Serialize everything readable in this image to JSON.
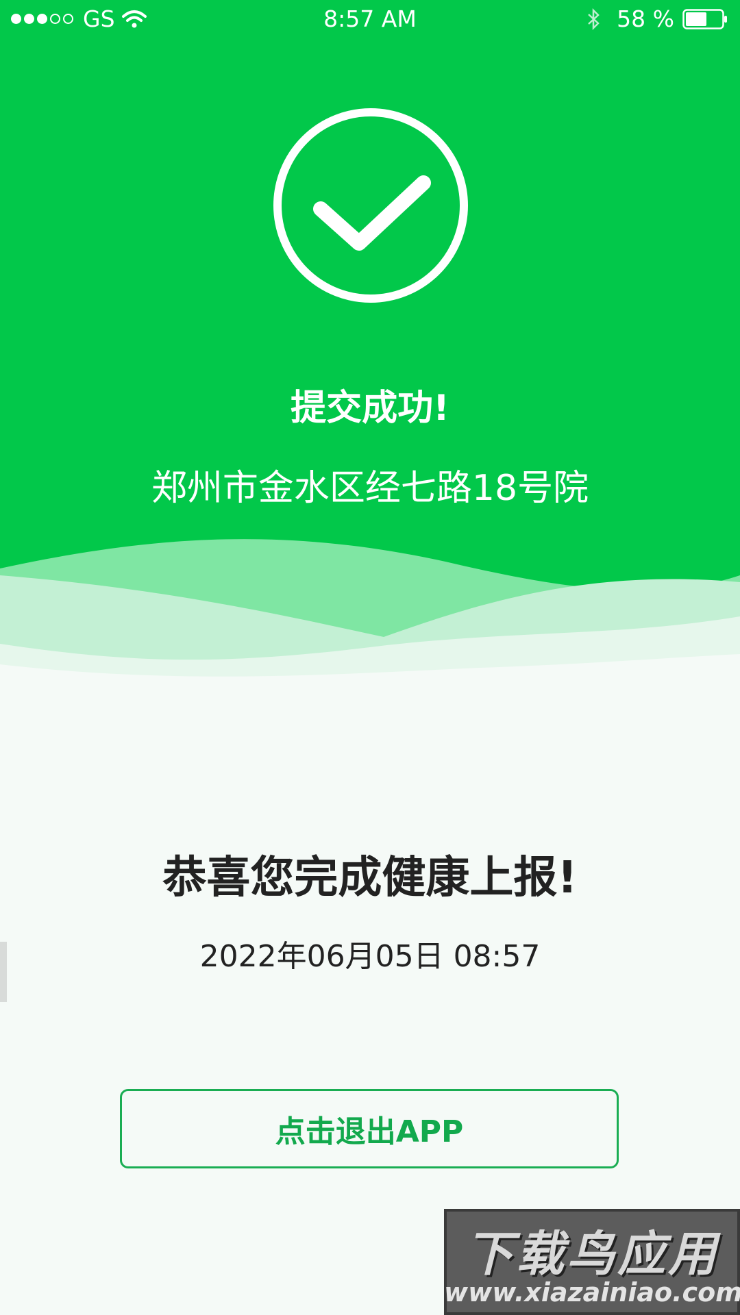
{
  "status_bar": {
    "carrier": "GS",
    "time": "8:57 AM",
    "battery": "58 %",
    "battery_level": 0.58,
    "signal_bars": 3,
    "signal_total": 5
  },
  "result": {
    "title": "提交成功!",
    "address": "郑州市金水区经七路18号院"
  },
  "message": {
    "congrats": "恭喜您完成健康上报!",
    "datetime": "2022年06月05日  08:57"
  },
  "actions": {
    "exit_label": "点击退出APP"
  },
  "watermark": {
    "logo_text": "下载鸟应用",
    "url": "www.xiazainiao.com"
  },
  "colors": {
    "primary_green": "#02c84a",
    "button_green": "#1aad53",
    "background": "#f5faf7"
  },
  "icons": {
    "hero": "check-circle-icon"
  }
}
